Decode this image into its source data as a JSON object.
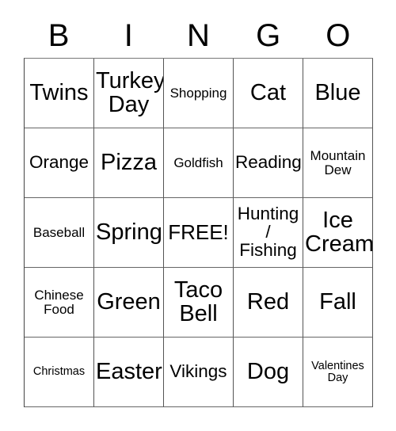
{
  "card": {
    "header_letters": [
      "B",
      "I",
      "N",
      "G",
      "O"
    ],
    "rows": [
      [
        {
          "text": "Twins",
          "size": "sz-xl"
        },
        {
          "text": "Turkey\nDay",
          "size": "sz-xl"
        },
        {
          "text": "Shopping",
          "size": "sz-sm"
        },
        {
          "text": "Cat",
          "size": "sz-xl"
        },
        {
          "text": "Blue",
          "size": "sz-xl"
        }
      ],
      [
        {
          "text": "Orange",
          "size": "sz-md"
        },
        {
          "text": "Pizza",
          "size": "sz-xl"
        },
        {
          "text": "Goldfish",
          "size": "sz-sm"
        },
        {
          "text": "Reading",
          "size": "sz-md"
        },
        {
          "text": "Mountain\nDew",
          "size": "sz-sm"
        }
      ],
      [
        {
          "text": "Baseball",
          "size": "sz-sm"
        },
        {
          "text": "Spring",
          "size": "sz-xl"
        },
        {
          "text": "FREE!",
          "size": "sz-lg"
        },
        {
          "text": "Hunting\n/\nFishing",
          "size": "sz-md"
        },
        {
          "text": "Ice\nCream",
          "size": "sz-xl"
        }
      ],
      [
        {
          "text": "Chinese\nFood",
          "size": "sz-sm"
        },
        {
          "text": "Green",
          "size": "sz-xl"
        },
        {
          "text": "Taco\nBell",
          "size": "sz-xl"
        },
        {
          "text": "Red",
          "size": "sz-xl"
        },
        {
          "text": "Fall",
          "size": "sz-xl"
        }
      ],
      [
        {
          "text": "Christmas",
          "size": "sz-xs"
        },
        {
          "text": "Easter",
          "size": "sz-xl"
        },
        {
          "text": "Vikings",
          "size": "sz-md"
        },
        {
          "text": "Dog",
          "size": "sz-xl"
        },
        {
          "text": "Valentines\nDay",
          "size": "sz-xs"
        }
      ]
    ],
    "free_space_label": "FREE!"
  },
  "colors": {
    "background": "#ffffff",
    "text": "#000000",
    "grid_border": "#555555"
  }
}
